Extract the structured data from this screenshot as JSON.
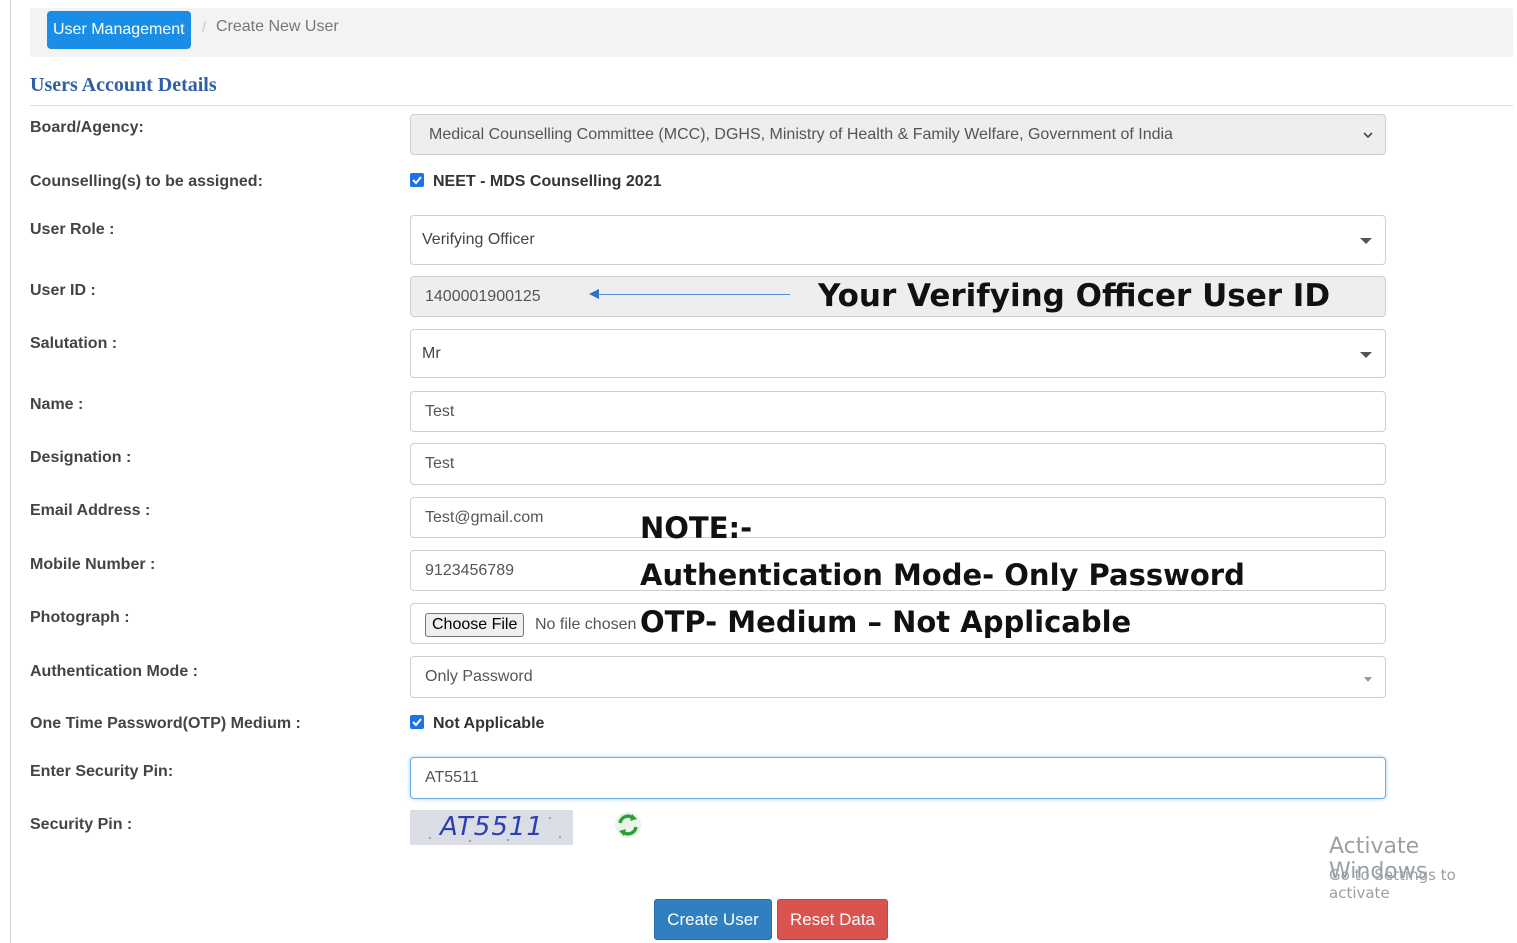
{
  "breadcrumb": {
    "active": "User Management",
    "separator": "/",
    "current": "Create New User"
  },
  "section_title": "Users Account Details",
  "labels": {
    "board": "Board/Agency:",
    "counselling": "Counselling(s) to be assigned:",
    "role": "User Role :",
    "userid": "User ID :",
    "salutation": "Salutation :",
    "name": "Name :",
    "designation": "Designation :",
    "email": "Email Address :",
    "mobile": "Mobile Number :",
    "photo": "Photograph :",
    "auth": "Authentication Mode :",
    "otp": "One Time Password(OTP) Medium :",
    "enter_pin": "Enter Security Pin:",
    "security_pin": "Security Pin :"
  },
  "fields": {
    "board_value": "Medical Counselling Committee (MCC), DGHS, Ministry of Health & Family Welfare, Government of India",
    "counselling_option": "NEET - MDS Counselling 2021",
    "counselling_checked": true,
    "role_value": "Verifying Officer",
    "userid_value": "1400001900125",
    "salutation_value": "Mr",
    "name_value": "Test",
    "designation_value": "Test",
    "email_value": "Test@gmail.com",
    "mobile_value": "9123456789",
    "photo_button": "Choose File",
    "photo_status": "No file chosen",
    "auth_value": "Only Password",
    "otp_option": "Not Applicable",
    "otp_checked": true,
    "pin_value": "AT5511"
  },
  "captcha_text": "AT5511",
  "annotations": {
    "userid_note": "Your Verifying Officer User ID",
    "note_title": "NOTE:-",
    "note_line1": "Authentication Mode- Only Password",
    "note_line2": "OTP- Medium – Not Applicable"
  },
  "buttons": {
    "create": "Create User",
    "reset": "Reset Data"
  },
  "watermark": {
    "line1": "Activate Windows",
    "line2": "Go to Settings to activate"
  },
  "colors": {
    "accent": "#1a8ee6",
    "section_title": "#2f5fa8",
    "create_button": "#2f7fc1",
    "reset_button": "#d9534f",
    "captcha_text": "#2b3fb0"
  }
}
